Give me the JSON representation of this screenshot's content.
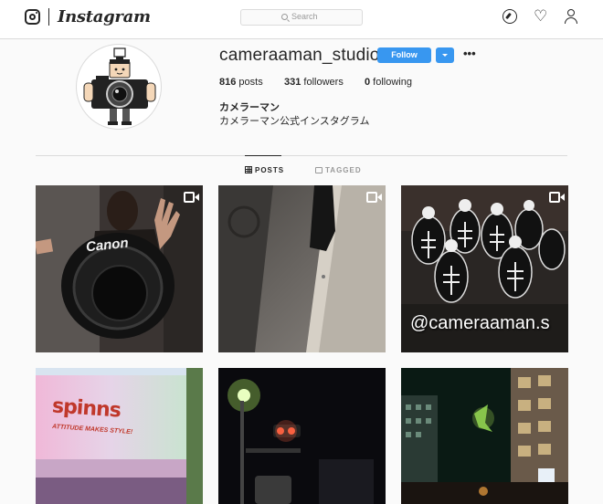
{
  "nav": {
    "brand": "Instagram",
    "search_placeholder": "Search"
  },
  "profile": {
    "username": "cameraaman_studio",
    "follow_label": "Follow",
    "more_label": "•••",
    "posts_count": "816",
    "posts_label": " posts",
    "followers_count": "331",
    "followers_label": " followers",
    "following_count": "0",
    "following_label": " following",
    "full_name": "カメラーマン",
    "bio": "カメラーマン公式インスタグラム"
  },
  "tabs": [
    {
      "label": "POSTS",
      "active": true
    },
    {
      "label": "TAGGED",
      "active": false
    }
  ],
  "posts": [
    {
      "overlay_text": "Canon",
      "is_video": true
    },
    {
      "overlay_text": "",
      "is_video": true
    },
    {
      "overlay_text": "@cameraaman.s",
      "is_video": true
    },
    {
      "overlay_text": "spinns",
      "subtext": "ATTITUDE MAKES STYLE!",
      "is_video": false
    },
    {
      "overlay_text": "",
      "is_video": false
    },
    {
      "overlay_text": "",
      "is_video": false
    }
  ],
  "colors": {
    "accent": "#3897f0",
    "border": "#dbdbdb",
    "background": "#fafafa"
  }
}
